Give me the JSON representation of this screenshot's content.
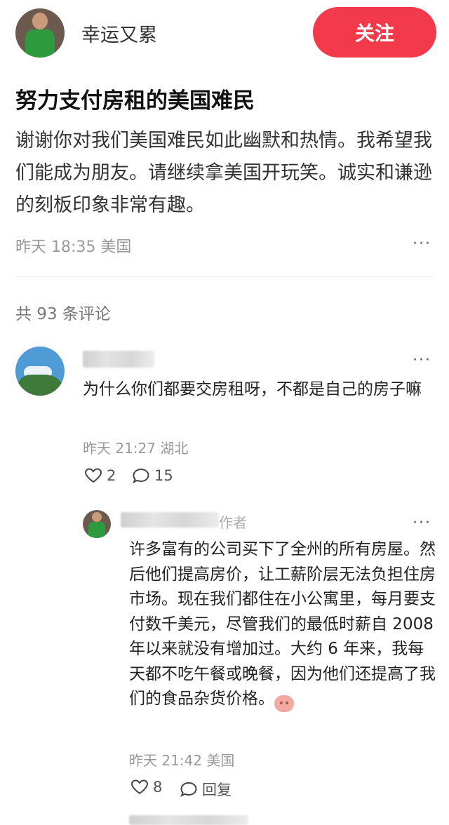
{
  "author": {
    "name": "幸运又累",
    "follow_label": "关注"
  },
  "post": {
    "title": "努力支付房租的美国难民",
    "body": "谢谢你对我们美国难民如此幽默和热情。我希望我们能成为朋友。请继续拿美国开玩笑。诚实和谦逊的刻板印象非常有趣。",
    "meta": "昨天 18:35 美国",
    "more": "···"
  },
  "comments_header": "共 93 条评论",
  "comments": [
    {
      "text": "为什么你们都要交房租呀，不都是自己的房子嘛",
      "meta": "昨天 21:27 湖北",
      "likes": "2",
      "replies": "15",
      "more": "···"
    }
  ],
  "reply": {
    "badge": "作者",
    "text": "许多富有的公司买下了全州的所有房屋。然后他们提高房价，让工薪阶层无法负担住房市场。现在我们都住在小公寓里，每月要支付数千美元，尽管我们的最低时薪自 2008 年以来就没有增加过。大约 6 年来，我每天都不吃午餐或晚餐，因为他们还提高了我们的食品杂货价格。",
    "meta": "昨天 21:42 美国",
    "likes": "8",
    "reply_label": "回复",
    "more": "···"
  },
  "icons": [
    "heart-icon",
    "comment-bubble-icon",
    "pig-emoji-icon",
    "more-icon"
  ]
}
